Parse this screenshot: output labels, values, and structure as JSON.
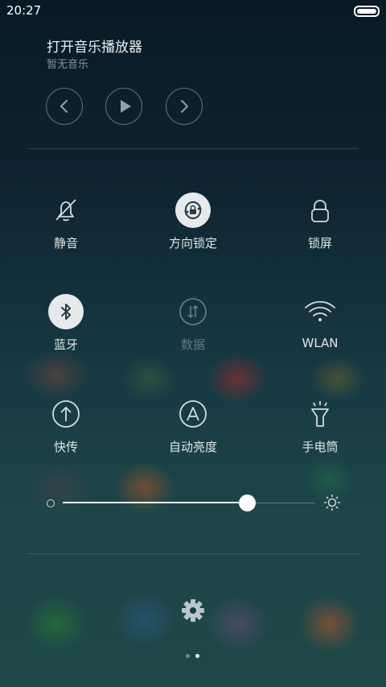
{
  "status_bar": {
    "time": "20:27"
  },
  "music": {
    "title": "打开音乐播放器",
    "subtitle": "暂无音乐",
    "controls": [
      "previous-icon",
      "play-icon",
      "next-icon"
    ]
  },
  "toggles": [
    {
      "label": "静音",
      "icon": "bell-off-icon",
      "active": false,
      "enabled": true
    },
    {
      "label": "方向锁定",
      "icon": "rotation-lock-icon",
      "active": true,
      "enabled": true
    },
    {
      "label": "锁屏",
      "icon": "lock-icon",
      "active": false,
      "enabled": true
    },
    {
      "label": "蓝牙",
      "icon": "bluetooth-icon",
      "active": true,
      "enabled": true
    },
    {
      "label": "数据",
      "icon": "mobile-data-icon",
      "active": false,
      "enabled": false
    },
    {
      "label": "WLAN",
      "icon": "wifi-icon",
      "active": false,
      "enabled": true
    },
    {
      "label": "快传",
      "icon": "upload-icon",
      "active": false,
      "enabled": true
    },
    {
      "label": "自动亮度",
      "icon": "auto-brightness-icon",
      "active": false,
      "enabled": true
    },
    {
      "label": "手电筒",
      "icon": "flashlight-icon",
      "active": false,
      "enabled": true
    }
  ],
  "brightness": {
    "value_percent": 73
  },
  "pager": {
    "pages": 2,
    "current": 2
  },
  "colors": {
    "active_tile": "#e6eaeb",
    "icon": "#d4dcdf",
    "disabled_icon": "#5e7883",
    "dot_active": "#ffffff",
    "dot_inactive": "#6f8790"
  }
}
